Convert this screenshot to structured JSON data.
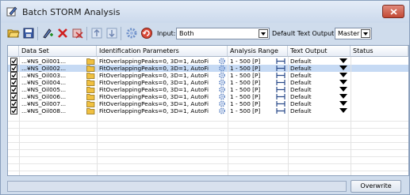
{
  "window": {
    "title": "Batch STORM Analysis"
  },
  "toolbar": {
    "icons": [
      "open-folder-icon",
      "save-icon",
      "add-icon",
      "delete-icon",
      "clear-icon",
      "move-up-icon",
      "move-down-icon",
      "settings-gear-icon",
      "refresh-icon"
    ],
    "input_label": "Input:",
    "input_value": "Both",
    "text_output_label": "Default Text Output:",
    "text_output_value": "Master"
  },
  "grid": {
    "columns": [
      "Data Set",
      "Identification Parameters",
      "Analysis Range",
      "Text Output",
      "Status"
    ],
    "rows": [
      {
        "checked": true,
        "dataset": "...¥NS_Oil001...",
        "params": "FitOverlappingPeaks=0, 3D=1, AutoFi",
        "range": "1 - 500 [P]",
        "output": "Default",
        "status": "",
        "selected": false
      },
      {
        "checked": true,
        "dataset": "...¥NS_Oil002...",
        "params": "FitOverlappingPeaks=0, 3D=1, AutoFi",
        "range": "1 - 500 [P]",
        "output": "Default",
        "status": "",
        "selected": true
      },
      {
        "checked": true,
        "dataset": "...¥NS_Oil003...",
        "params": "FitOverlappingPeaks=0, 3D=1, AutoFi",
        "range": "1 - 500 [P]",
        "output": "Default",
        "status": "",
        "selected": false
      },
      {
        "checked": true,
        "dataset": "...¥NS_Oil004...",
        "params": "FitOverlappingPeaks=0, 3D=1, AutoFi",
        "range": "1 - 500 [P]",
        "output": "Default",
        "status": "",
        "selected": false
      },
      {
        "checked": true,
        "dataset": "...¥NS_Oil005...",
        "params": "FitOverlappingPeaks=0, 3D=1, AutoFi",
        "range": "1 - 500 [P]",
        "output": "Default",
        "status": "",
        "selected": false
      },
      {
        "checked": true,
        "dataset": "...¥NS_Oil006...",
        "params": "FitOverlappingPeaks=0, 3D=1, AutoFi",
        "range": "1 - 500 [P]",
        "output": "Default",
        "status": "",
        "selected": false
      },
      {
        "checked": true,
        "dataset": "...¥NS_Oil007...",
        "params": "FitOverlappingPeaks=0, 3D=1, AutoFi",
        "range": "1 - 500 [P]",
        "output": "Default",
        "status": "",
        "selected": false
      },
      {
        "checked": true,
        "dataset": "...¥NS_Oil008...",
        "params": "FitOverlappingPeaks=0, 3D=1, AutoFi",
        "range": "1 - 500 [P]",
        "output": "Default",
        "status": "",
        "selected": false
      }
    ]
  },
  "statusbar": {
    "status_text": "",
    "overwrite_label": "Overwrite"
  },
  "colors": {
    "window_bg": "#cfdcec",
    "selection": "#c6daf4",
    "close": "#c24a35"
  }
}
